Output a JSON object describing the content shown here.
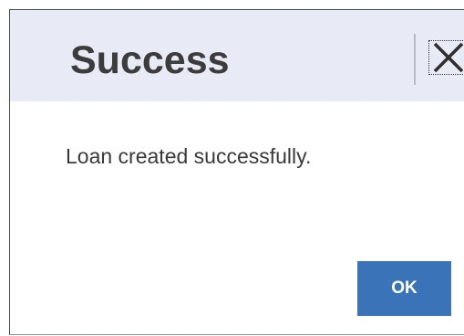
{
  "dialog": {
    "title": "Success",
    "message": "Loan created successfully.",
    "close_icon": "close-icon",
    "ok_label": "OK"
  },
  "colors": {
    "header_background": "#e8ebf5",
    "title_text": "#3c3c3c",
    "message_text": "#3a3a3a",
    "ok_button_background": "#3a73b8",
    "ok_button_text": "#ffffff"
  }
}
